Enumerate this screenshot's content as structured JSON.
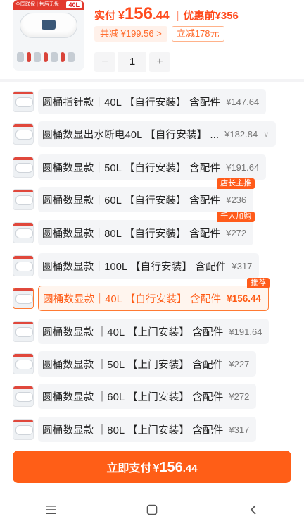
{
  "product": {
    "image_banner": "全国联保 | 售后无忧",
    "image_capacity": "40L",
    "actual_label": "实付",
    "price_currency": "¥",
    "price_int": "156",
    "price_dec": ".44",
    "separator": "|",
    "original_label": "优惠前",
    "original_price": "¥356",
    "total_discount": "共减 ¥199.56 >",
    "instant_discount": "立减178元",
    "quantity": "1",
    "minus_label": "−",
    "plus_label": "+"
  },
  "variants": [
    {
      "name": "圆桶指针款｜40L 【自行安装】 含配件",
      "price": "¥147.64",
      "tag": "",
      "selected": false
    },
    {
      "name": "圆桶数显出水断电40L 【自行安装】 ...",
      "price": "¥182.84",
      "tag": "",
      "selected": false,
      "expand": "∨"
    },
    {
      "name": "圆桶数显款｜50L 【自行安装】 含配件",
      "price": "¥191.64",
      "tag": "",
      "selected": false
    },
    {
      "name": "圆桶数显款｜60L 【自行安装】 含配件",
      "price": "¥236",
      "tag": "店长主推",
      "selected": false
    },
    {
      "name": "圆桶数显款｜80L 【自行安装】 含配件",
      "price": "¥272",
      "tag": "千人加购",
      "selected": false
    },
    {
      "name": "圆桶数显款｜100L 【自行安装】 含配件",
      "price": "¥317",
      "tag": "",
      "selected": false
    },
    {
      "name": "圆桶数显款｜40L 【自行安装】 含配件",
      "price": "¥156.44",
      "tag": "推荐",
      "selected": true
    },
    {
      "name": "圆桶数显款 ｜40L 【上门安装】 含配件",
      "price": "¥191.64",
      "tag": "",
      "selected": false
    },
    {
      "name": "圆桶数显款 ｜50L 【上门安装】 含配件",
      "price": "¥227",
      "tag": "",
      "selected": false
    },
    {
      "name": "圆桶数显款 ｜60L 【上门安装】 含配件",
      "price": "¥272",
      "tag": "",
      "selected": false
    },
    {
      "name": "圆桶数显款 ｜80L 【上门安装】 含配件",
      "price": "¥317",
      "tag": "",
      "selected": false
    }
  ],
  "pay_button": {
    "label": "立即支付",
    "currency": "¥",
    "int": "156",
    "dec": ".44"
  },
  "navbar": {
    "icons": [
      "menu-icon",
      "home-square-icon",
      "back-icon"
    ]
  },
  "colors": {
    "accent": "#ff5e17",
    "price": "#ff4a1c"
  }
}
